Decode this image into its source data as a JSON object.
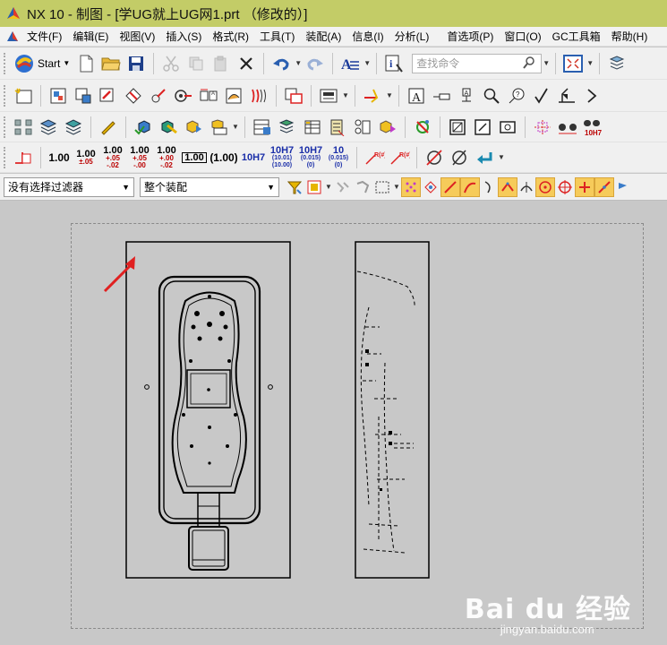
{
  "window": {
    "title": "NX 10 - 制图 - [学UG就上UG网1.prt （修改的）]"
  },
  "menu": {
    "items": [
      "文件(F)",
      "编辑(E)",
      "视图(V)",
      "插入(S)",
      "格式(R)",
      "工具(T)",
      "装配(A)",
      "信息(I)",
      "分析(L)"
    ],
    "right_items": [
      "首选项(P)",
      "窗口(O)",
      "GC工具箱",
      "帮助(H)"
    ]
  },
  "toolbar1": {
    "start_label": "Start",
    "search_placeholder": "查找命令"
  },
  "toolbar4": {
    "precision": [
      {
        "main": "1.00",
        "sub": ""
      },
      {
        "main": "1.00",
        "sub": "±.05"
      },
      {
        "main": "1.00",
        "sub": "+.05",
        "sub2": "-.02"
      },
      {
        "main": "1.00",
        "sub": "+.05",
        "sub2": "-.00"
      },
      {
        "main": "1.00",
        "sub": "+.00",
        "sub2": "-.02"
      }
    ],
    "boxed": "1.00",
    "paren": "(1.00)",
    "fit": "10H7",
    "fit2_main": "10H7",
    "fit2_sub": "(10.01)",
    "fit2_sub2": "(10.00)",
    "fit3_main": "10H7",
    "fit3_sub": "(0.015)",
    "fit3_sub2": "(0)",
    "fit4_main": "10",
    "fit4_sub": "(0.015)",
    "fit4_sub2": "(0)",
    "toolbar3_fit": "10H7"
  },
  "filters": {
    "selection_filter": "没有选择过滤器",
    "scope": "整个装配"
  },
  "watermark": {
    "brand": "Bai du 经验",
    "url": "jingyan.baidu.com"
  },
  "colors": {
    "titlebar": "#c3cc67",
    "toolbar": "#f0f0f0",
    "canvas": "#c8c8c8",
    "highlight": "#f6cb5a",
    "arrow": "#e02020"
  }
}
